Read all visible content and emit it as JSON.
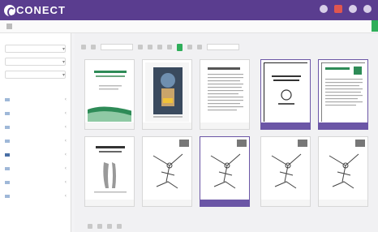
{
  "app": {
    "name": "CONECT"
  },
  "topbar": {
    "icons": [
      "bell-icon",
      "flag-icon",
      "help-icon",
      "user-icon"
    ],
    "brand_color": "#5a3d8f",
    "alert_color": "#e0564f"
  },
  "breadcrumb": {
    "path": ""
  },
  "sidebar": {
    "fields": [
      "",
      "",
      ""
    ],
    "tree": [
      "",
      "",
      "",
      "",
      "",
      "",
      "",
      ""
    ]
  },
  "cards": [
    "",
    "",
    "",
    "",
    "",
    "",
    "",
    "",
    "",
    ""
  ],
  "accent_color": "#6b56a6",
  "action_color": "#2fae5a"
}
